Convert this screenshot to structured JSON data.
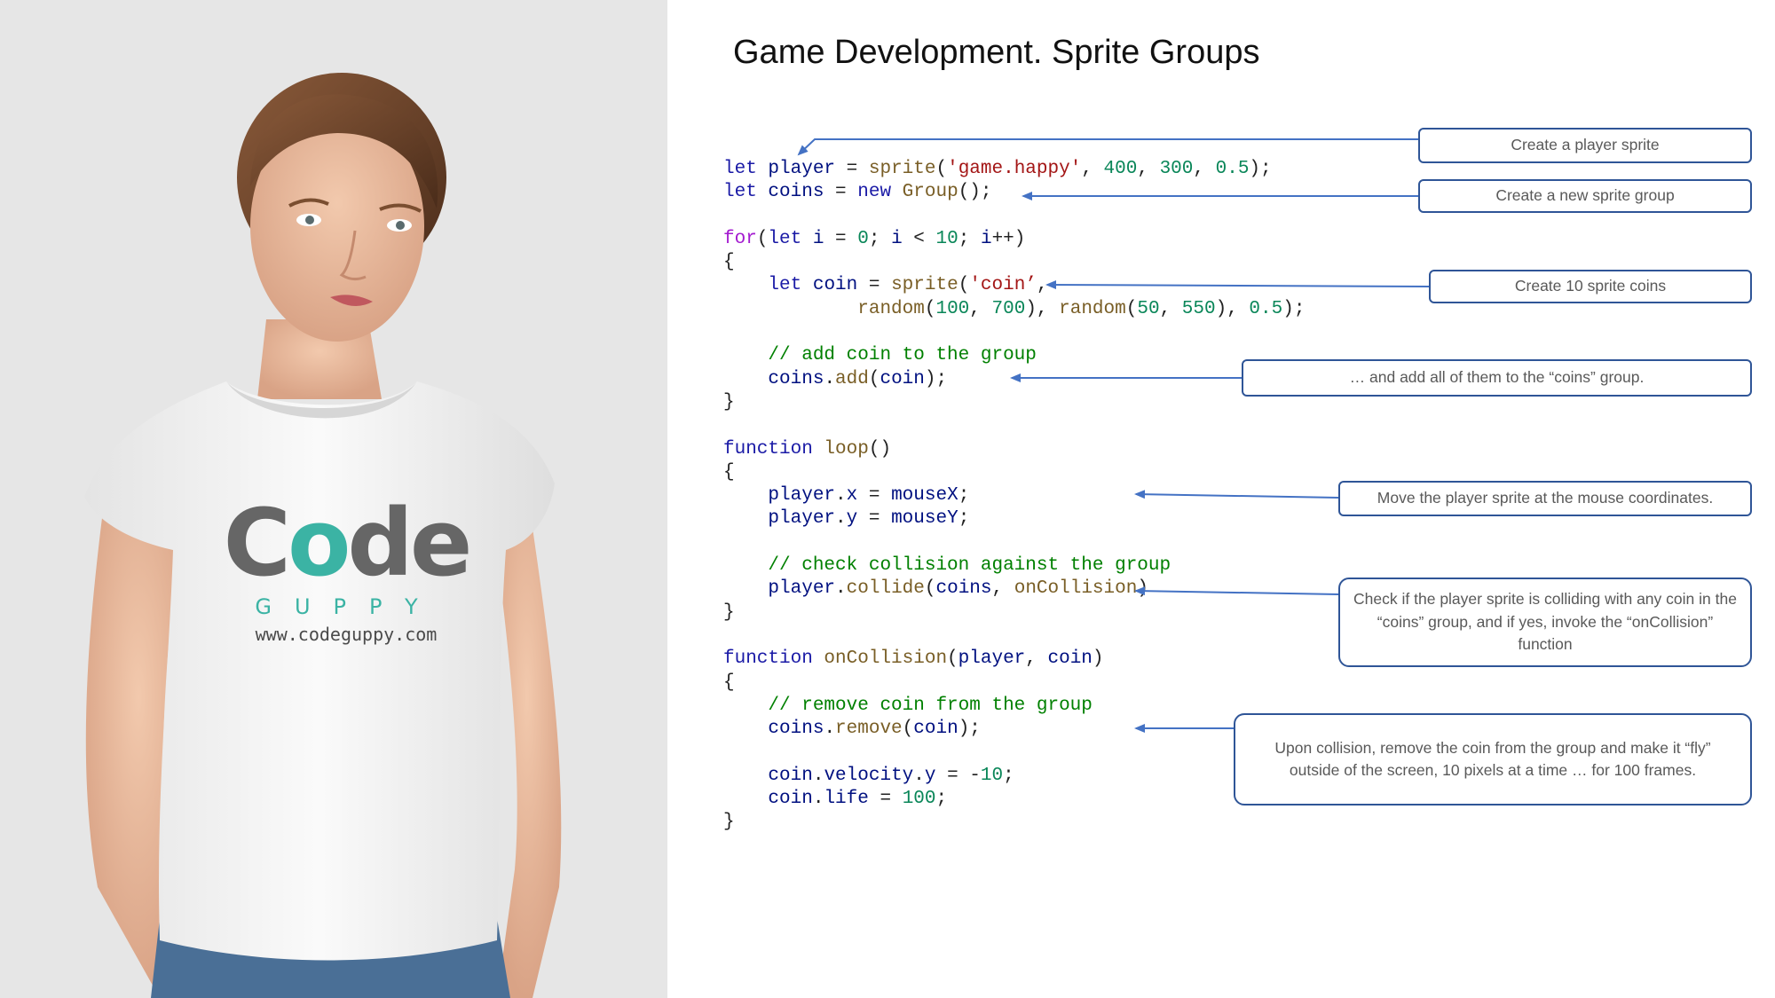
{
  "title": "Game Development. Sprite Groups",
  "shirt": {
    "logo_c": "C",
    "logo_o": "o",
    "logo_de": "de",
    "logo_sub": "GUPPY",
    "url": "www.codeguppy.com"
  },
  "code_lines": [
    [
      [
        "kw",
        "let "
      ],
      [
        "id",
        "player"
      ],
      [
        "p",
        " = "
      ],
      [
        "fn",
        "sprite"
      ],
      [
        "p",
        "("
      ],
      [
        "str",
        "'game.happy'"
      ],
      [
        "p",
        ", "
      ],
      [
        "num",
        "400"
      ],
      [
        "p",
        ", "
      ],
      [
        "num",
        "300"
      ],
      [
        "p",
        ", "
      ],
      [
        "num",
        "0.5"
      ],
      [
        "p",
        ");"
      ]
    ],
    [
      [
        "kw",
        "let "
      ],
      [
        "id",
        "coins"
      ],
      [
        "p",
        " = "
      ],
      [
        "kw",
        "new "
      ],
      [
        "fn",
        "Group"
      ],
      [
        "p",
        "();"
      ]
    ],
    [],
    [
      [
        "kwc",
        "for"
      ],
      [
        "p",
        "("
      ],
      [
        "kw",
        "let "
      ],
      [
        "id",
        "i"
      ],
      [
        "p",
        " = "
      ],
      [
        "num",
        "0"
      ],
      [
        "p",
        "; "
      ],
      [
        "id",
        "i"
      ],
      [
        "p",
        " < "
      ],
      [
        "num",
        "10"
      ],
      [
        "p",
        "; "
      ],
      [
        "id",
        "i"
      ],
      [
        "p",
        "++)"
      ]
    ],
    [
      [
        "p",
        "{"
      ]
    ],
    [
      [
        "p",
        "    "
      ],
      [
        "kw",
        "let "
      ],
      [
        "id",
        "coin"
      ],
      [
        "p",
        " = "
      ],
      [
        "fn",
        "sprite"
      ],
      [
        "p",
        "("
      ],
      [
        "str",
        "'coin’"
      ],
      [
        "p",
        ","
      ]
    ],
    [
      [
        "p",
        "            "
      ],
      [
        "fn",
        "random"
      ],
      [
        "p",
        "("
      ],
      [
        "num",
        "100"
      ],
      [
        "p",
        ", "
      ],
      [
        "num",
        "700"
      ],
      [
        "p",
        "), "
      ],
      [
        "fn",
        "random"
      ],
      [
        "p",
        "("
      ],
      [
        "num",
        "50"
      ],
      [
        "p",
        ", "
      ],
      [
        "num",
        "550"
      ],
      [
        "p",
        "), "
      ],
      [
        "num",
        "0.5"
      ],
      [
        "p",
        ");"
      ]
    ],
    [],
    [
      [
        "p",
        "    "
      ],
      [
        "com",
        "// add coin to the group"
      ]
    ],
    [
      [
        "p",
        "    "
      ],
      [
        "id",
        "coins"
      ],
      [
        "p",
        "."
      ],
      [
        "fn",
        "add"
      ],
      [
        "p",
        "("
      ],
      [
        "id",
        "coin"
      ],
      [
        "p",
        ");"
      ]
    ],
    [
      [
        "p",
        "}"
      ]
    ],
    [],
    [
      [
        "kw",
        "function "
      ],
      [
        "fn",
        "loop"
      ],
      [
        "p",
        "()"
      ]
    ],
    [
      [
        "p",
        "{"
      ]
    ],
    [
      [
        "p",
        "    "
      ],
      [
        "id",
        "player"
      ],
      [
        "p",
        "."
      ],
      [
        "id",
        "x"
      ],
      [
        "p",
        " = "
      ],
      [
        "id",
        "mouseX"
      ],
      [
        "p",
        ";"
      ]
    ],
    [
      [
        "p",
        "    "
      ],
      [
        "id",
        "player"
      ],
      [
        "p",
        "."
      ],
      [
        "id",
        "y"
      ],
      [
        "p",
        " = "
      ],
      [
        "id",
        "mouseY"
      ],
      [
        "p",
        ";"
      ]
    ],
    [],
    [
      [
        "p",
        "    "
      ],
      [
        "com",
        "// check collision against the group"
      ]
    ],
    [
      [
        "p",
        "    "
      ],
      [
        "id",
        "player"
      ],
      [
        "p",
        "."
      ],
      [
        "fn",
        "collide"
      ],
      [
        "p",
        "("
      ],
      [
        "id",
        "coins"
      ],
      [
        "p",
        ", "
      ],
      [
        "fn",
        "onCollision"
      ],
      [
        "p",
        ")"
      ]
    ],
    [
      [
        "p",
        "}"
      ]
    ],
    [],
    [
      [
        "kw",
        "function "
      ],
      [
        "fn",
        "onCollision"
      ],
      [
        "p",
        "("
      ],
      [
        "id",
        "player"
      ],
      [
        "p",
        ", "
      ],
      [
        "id",
        "coin"
      ],
      [
        "p",
        ")"
      ]
    ],
    [
      [
        "p",
        "{"
      ]
    ],
    [
      [
        "p",
        "    "
      ],
      [
        "com",
        "// remove coin from the group"
      ]
    ],
    [
      [
        "p",
        "    "
      ],
      [
        "id",
        "coins"
      ],
      [
        "p",
        "."
      ],
      [
        "fn",
        "remove"
      ],
      [
        "p",
        "("
      ],
      [
        "id",
        "coin"
      ],
      [
        "p",
        ");"
      ]
    ],
    [],
    [
      [
        "p",
        "    "
      ],
      [
        "id",
        "coin"
      ],
      [
        "p",
        "."
      ],
      [
        "id",
        "velocity"
      ],
      [
        "p",
        "."
      ],
      [
        "id",
        "y"
      ],
      [
        "p",
        " = -"
      ],
      [
        "num",
        "10"
      ],
      [
        "p",
        ";"
      ]
    ],
    [
      [
        "p",
        "    "
      ],
      [
        "id",
        "coin"
      ],
      [
        "p",
        "."
      ],
      [
        "id",
        "life"
      ],
      [
        "p",
        " = "
      ],
      [
        "num",
        "100"
      ],
      [
        "p",
        ";"
      ]
    ],
    [
      [
        "p",
        "}"
      ]
    ]
  ],
  "callouts": {
    "player_sprite": "Create a player sprite",
    "sprite_group": "Create a new sprite group",
    "coins": "Create 10 sprite coins",
    "add_group": "… and add all of them to the “coins” group.",
    "move_player": "Move the player sprite at the mouse coordinates.",
    "check_collision": "Check if the player sprite is colliding with any coin in the “coins” group, and if yes, invoke the “onCollision” function",
    "upon_collision": "Upon collision, remove the coin from the group and make it “fly” outside of the screen, 10 pixels at a time … for 100 frames."
  },
  "colors": {
    "callout_border": "#2f5597",
    "arrow": "#4472c4",
    "left_background": "#e6e6e6",
    "logo_teal": "#3bb3a4",
    "logo_gray": "#666666"
  }
}
